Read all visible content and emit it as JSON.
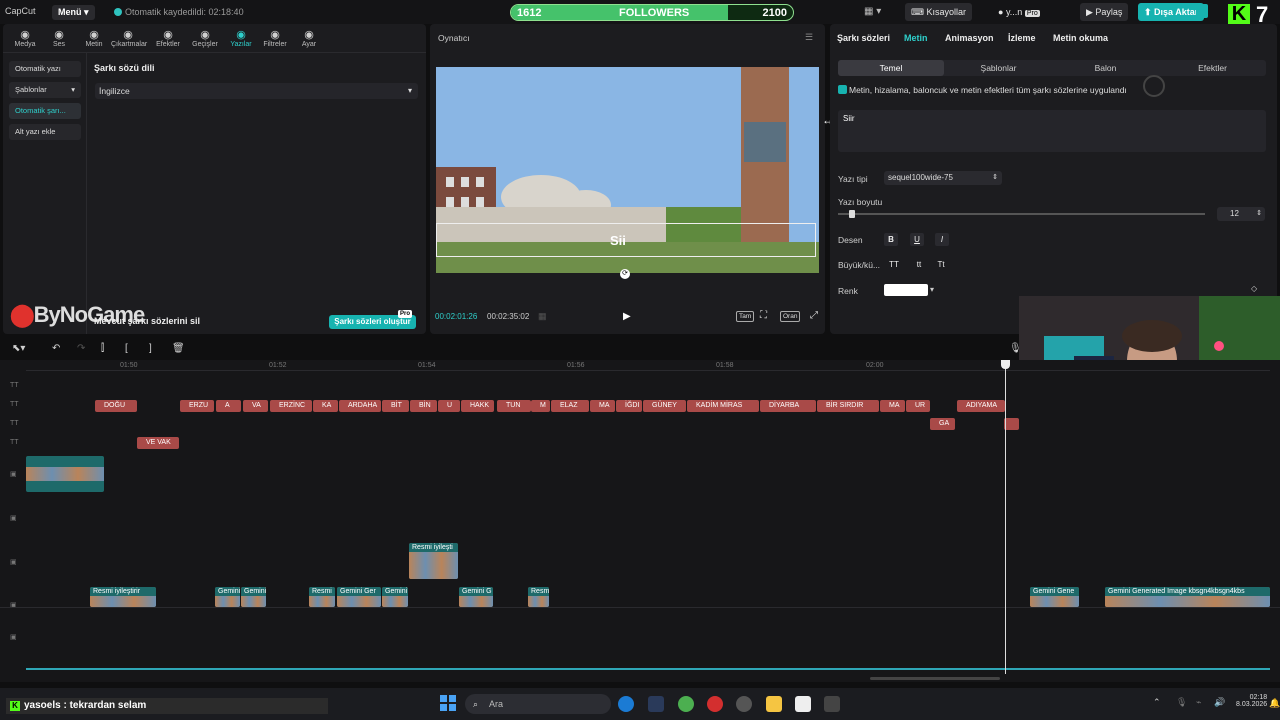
{
  "topbar": {
    "app_name": "CapCut",
    "menu_label": "Menü",
    "autosave_text": "Otomatik kaydedildi: 02:18:40",
    "kisayollar_label": "Kısayollar",
    "user_label": "y...n",
    "pro_label": "Pro",
    "share_label": "Paylaş",
    "export_label": "Dışa Aktar",
    "overlay_number": "7"
  },
  "followers_goal": {
    "current": "1612",
    "label": "FOLLOWERS",
    "target": "2100",
    "progress": 0.77
  },
  "tools": [
    {
      "label": "Medya",
      "icon": "media-icon"
    },
    {
      "label": "Ses",
      "icon": "audio-icon"
    },
    {
      "label": "Metin",
      "icon": "text-icon"
    },
    {
      "label": "Çıkartmalar",
      "icon": "sticker-icon"
    },
    {
      "label": "Efektler",
      "icon": "effects-icon"
    },
    {
      "label": "Geçişler",
      "icon": "transitions-icon"
    },
    {
      "label": "Yazılar",
      "icon": "captions-icon"
    },
    {
      "label": "Filtreler",
      "icon": "filters-icon"
    },
    {
      "label": "Ayar",
      "icon": "adjust-icon"
    }
  ],
  "sidenav": [
    "Otomatik yazı",
    "Şablonlar",
    "Otomatik şarı...",
    "Alt yazı ekle"
  ],
  "lyrics_panel": {
    "title": "Şarkı sözü dili",
    "language": "İngilizce",
    "delete_label": "Mevcut şarkı sözlerini sil",
    "create_label": "Şarkı sözleri oluştur",
    "badge": "Pro"
  },
  "watermark": "ByNoGame",
  "player": {
    "title": "Oynatıcı",
    "overlay_text": "Sii",
    "current_time": "00:02:01:26",
    "total_time": "00:02:35:02",
    "btn_full": "Tam",
    "btn_ratio": "Oran"
  },
  "right_panel": {
    "tabs": [
      "Şarkı sözleri",
      "Metin",
      "Animasyon",
      "İzleme",
      "Metin okuma"
    ],
    "subtabs": [
      "Temel",
      "Şablonlar",
      "Balon",
      "Efektler"
    ],
    "apply_all": "Metin, hizalama, baloncuk ve metin efektleri tüm şarkı sözlerine uygulandı",
    "text_value": "Siir",
    "font_label": "Yazı tipi",
    "font_value": "sequel100wide-75",
    "size_label": "Yazı boyutu",
    "size_value": "12",
    "size_fraction": 0.03,
    "style_label": "Desen",
    "case_label": "Büyük/kü...",
    "case_options": [
      "TT",
      "tt",
      "Tt"
    ],
    "color_label": "Renk",
    "text_color": "#ffffff"
  },
  "timeline": {
    "ruler": [
      "01:50",
      "01:52",
      "01:54",
      "01:56",
      "01:58",
      "02:00"
    ],
    "red_clips_row1": [
      "DOĞU",
      "ERZU",
      "A",
      "VA",
      "ERZİNC",
      "KA",
      "ARDAHA",
      "BİT",
      "BİN",
      "U",
      "HAKK",
      "TUN",
      "M",
      "ELAZ",
      "MA",
      "İĞDI",
      "GÜNEY",
      "KADİM MİRAS",
      "DİYARBA",
      "BİR SIRDIR",
      "MA",
      "UR",
      "ADIYAMA"
    ],
    "red_clips_row2": [
      "GA"
    ],
    "red_clips_row3": [
      "VE VAK"
    ],
    "image_clip_mid": "Resmi iyileşti",
    "image_clips_bottom": [
      "Resmi iyileştirir",
      "Gemini",
      "Gemini",
      "Resmi",
      "Gemini Ger",
      "Gemini",
      "Gemini G",
      "Resm",
      "Gemini Gene",
      "Gemini Generated Image kbsgn4kbsgn4kbs"
    ]
  },
  "taskbar": {
    "chat": "yasoels : tekrardan selam",
    "search_placeholder": "Ara",
    "time": "02:18",
    "date": "8.03.2026"
  },
  "colors": {
    "accent": "#17b3b0",
    "clip_red": "#a94a48",
    "kick_green": "#53fc18"
  }
}
